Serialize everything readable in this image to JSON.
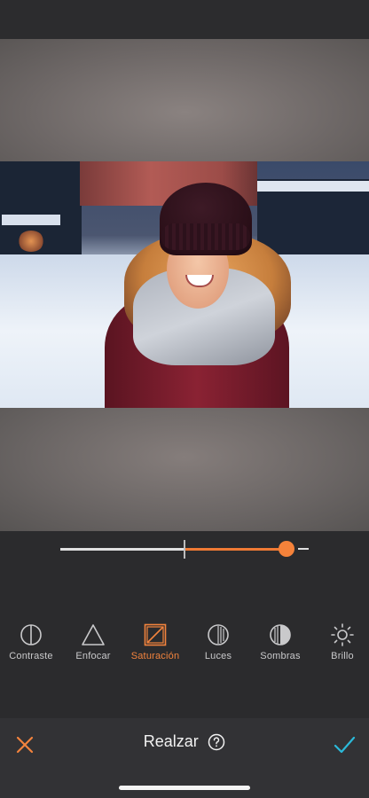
{
  "editor": {
    "slider": {
      "min": -100,
      "max": 100,
      "value": 82,
      "center_value": 0
    }
  },
  "tools": [
    {
      "id": "contraste",
      "label": "Contraste",
      "icon": "contrast-icon",
      "active": false
    },
    {
      "id": "enfocar",
      "label": "Enfocar",
      "icon": "sharpen-triangle-icon",
      "active": false
    },
    {
      "id": "saturacion",
      "label": "Saturación",
      "icon": "saturation-icon",
      "active": true
    },
    {
      "id": "luces",
      "label": "Luces",
      "icon": "highlights-icon",
      "active": false
    },
    {
      "id": "sombras",
      "label": "Sombras",
      "icon": "shadows-icon",
      "active": false
    },
    {
      "id": "brillo",
      "label": "Brillo",
      "icon": "brightness-sun-icon",
      "active": false
    }
  ],
  "bottom_bar": {
    "title": "Realzar",
    "help_icon": "help-circle-icon",
    "cancel_icon": "close-icon",
    "confirm_icon": "checkmark-icon"
  },
  "colors": {
    "accent": "#f2833d",
    "confirm": "#2bb9d9",
    "background": "#2b2b2d"
  }
}
